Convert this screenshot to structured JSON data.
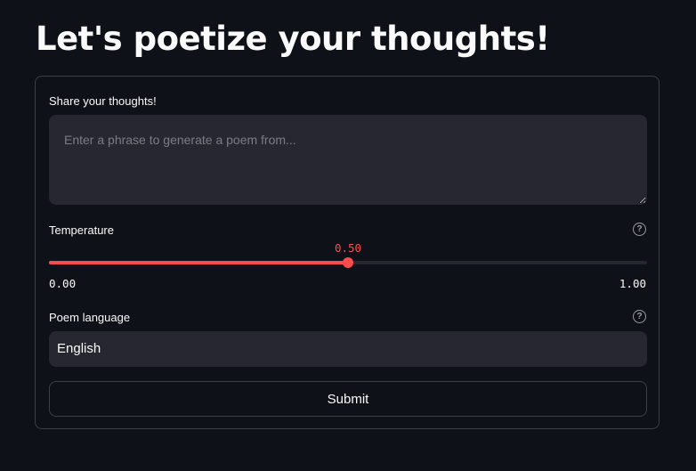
{
  "header": {
    "title": "Let's poetize your thoughts!"
  },
  "form": {
    "thoughts": {
      "label": "Share your thoughts!",
      "value": "",
      "placeholder": "Enter a phrase to generate a poem from..."
    },
    "temperature": {
      "label": "Temperature",
      "value": 0.5,
      "value_text": "0.50",
      "min": 0,
      "min_text": "0.00",
      "max": 1,
      "max_text": "1.00",
      "help_icon": "question-circle-icon"
    },
    "language": {
      "label": "Poem language",
      "selected": "English",
      "help_icon": "question-circle-icon"
    },
    "submit_label": "Submit"
  },
  "colors": {
    "background": "#0e1117",
    "input_background": "#262730",
    "accent": "#ff4b4b",
    "text": "#fafafa"
  }
}
